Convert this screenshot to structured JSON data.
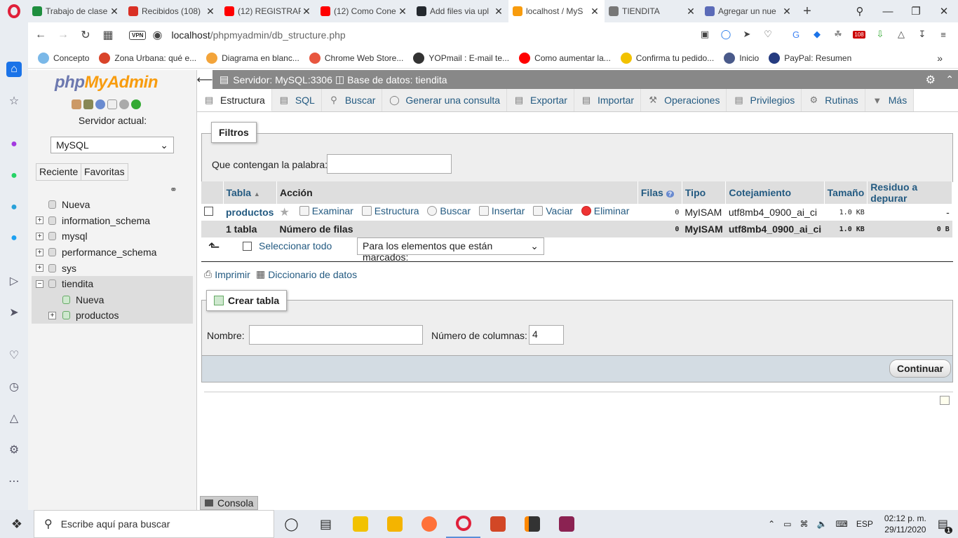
{
  "browser": {
    "tabs": [
      {
        "title": "Trabajo de clase",
        "icon": "classroom-icon",
        "color": "#1e8e3e"
      },
      {
        "title": "Recibidos (108)",
        "icon": "gmail-icon",
        "color": "#d93025"
      },
      {
        "title": "(12) REGISTRAR",
        "icon": "youtube-icon",
        "color": "#ff0000"
      },
      {
        "title": "(12) Como Cone",
        "icon": "youtube-icon",
        "color": "#ff0000"
      },
      {
        "title": "Add files via upl",
        "icon": "github-icon",
        "color": "#24292e"
      },
      {
        "title": "localhost / MyS",
        "icon": "phpmyadmin-icon",
        "color": "#f89c0e"
      },
      {
        "title": "TIENDITA",
        "icon": "document-icon",
        "color": "#777777"
      },
      {
        "title": "Agregar un nue",
        "icon": "bracket-icon",
        "color": "#5b6bb8"
      }
    ],
    "url_host": "localhost",
    "url_path": "/phpmyadmin/db_structure.php",
    "vpn_label": "VPN",
    "bookmarks": [
      {
        "label": "Concepto",
        "color": "#7ab8e8"
      },
      {
        "label": "Zona Urbana: qué e...",
        "color": "#d9442a"
      },
      {
        "label": "Diagrama en blanc...",
        "color": "#f3a43a"
      },
      {
        "label": "Chrome Web Store...",
        "color": "#e8563f"
      },
      {
        "label": "YOPmail : E-mail te...",
        "color": "#333333"
      },
      {
        "label": "Como aumentar la...",
        "color": "#ff0000"
      },
      {
        "label": "Confirma tu pedido...",
        "color": "#f2c200"
      },
      {
        "label": "Inicio",
        "color": "#4a5a8a"
      },
      {
        "label": "PayPal: Resumen",
        "color": "#253b80"
      }
    ],
    "badge_count": "108"
  },
  "pma_left": {
    "logo_php": "php",
    "logo_my": "MyAdmin",
    "server_label": "Servidor actual:",
    "server_select": "MySQL",
    "recent_btn": "Reciente",
    "favorites_btn": "Favoritas",
    "tree": [
      {
        "label": "Nueva"
      },
      {
        "label": "information_schema"
      },
      {
        "label": "mysql"
      },
      {
        "label": "performance_schema"
      },
      {
        "label": "sys"
      },
      {
        "label": "tiendita"
      },
      {
        "label": "Nueva"
      },
      {
        "label": "productos"
      }
    ]
  },
  "pma_main": {
    "breadcrumb_server": "Servidor: MySQL:3306",
    "breadcrumb_db": "Base de datos: tiendita",
    "tabs": [
      {
        "label": "Estructura",
        "icon": "structure-icon"
      },
      {
        "label": "SQL",
        "icon": "sql-icon"
      },
      {
        "label": "Buscar",
        "icon": "search-icon"
      },
      {
        "label": "Generar una consulta",
        "icon": "query-icon"
      },
      {
        "label": "Exportar",
        "icon": "export-icon"
      },
      {
        "label": "Importar",
        "icon": "import-icon"
      },
      {
        "label": "Operaciones",
        "icon": "wrench-icon"
      },
      {
        "label": "Privilegios",
        "icon": "privileges-icon"
      },
      {
        "label": "Rutinas",
        "icon": "routines-icon"
      },
      {
        "label": "Más",
        "icon": "chevron-down-icon"
      }
    ],
    "filters": {
      "legend": "Filtros",
      "label": "Que contengan la palabra:",
      "value": ""
    },
    "table": {
      "headers": [
        "Tabla",
        "Acción",
        "Filas",
        "Tipo",
        "Cotejamiento",
        "Tamaño",
        "Residuo a depurar"
      ],
      "rows": [
        {
          "name": "productos",
          "actions": [
            "Examinar",
            "Estructura",
            "Buscar",
            "Insertar",
            "Vaciar",
            "Eliminar"
          ],
          "rows": "0",
          "type": "MyISAM",
          "collation": "utf8mb4_0900_ai_ci",
          "size": "1.0 KB",
          "overhead": "-"
        }
      ],
      "footer": {
        "count": "1 tabla",
        "label": "Número de filas",
        "rows": "0",
        "type": "MyISAM",
        "collation": "utf8mb4_0900_ai_ci",
        "size": "1.0 KB",
        "overhead": "0 B"
      }
    },
    "select_all": "Seleccionar todo",
    "with_selected": "Para los elementos que están marcados:",
    "print_link": "Imprimir",
    "dict_link": "Diccionario de datos",
    "create": {
      "legend": "Crear tabla",
      "name_label": "Nombre:",
      "name_value": "",
      "cols_label": "Número de columnas:",
      "cols_value": "4",
      "submit": "Continuar"
    },
    "console": "Consola"
  },
  "taskbar": {
    "search_placeholder": "Escribe aquí para buscar",
    "lang": "ESP",
    "time": "02:12 p. m.",
    "date": "29/11/2020",
    "notif_count": "1"
  }
}
